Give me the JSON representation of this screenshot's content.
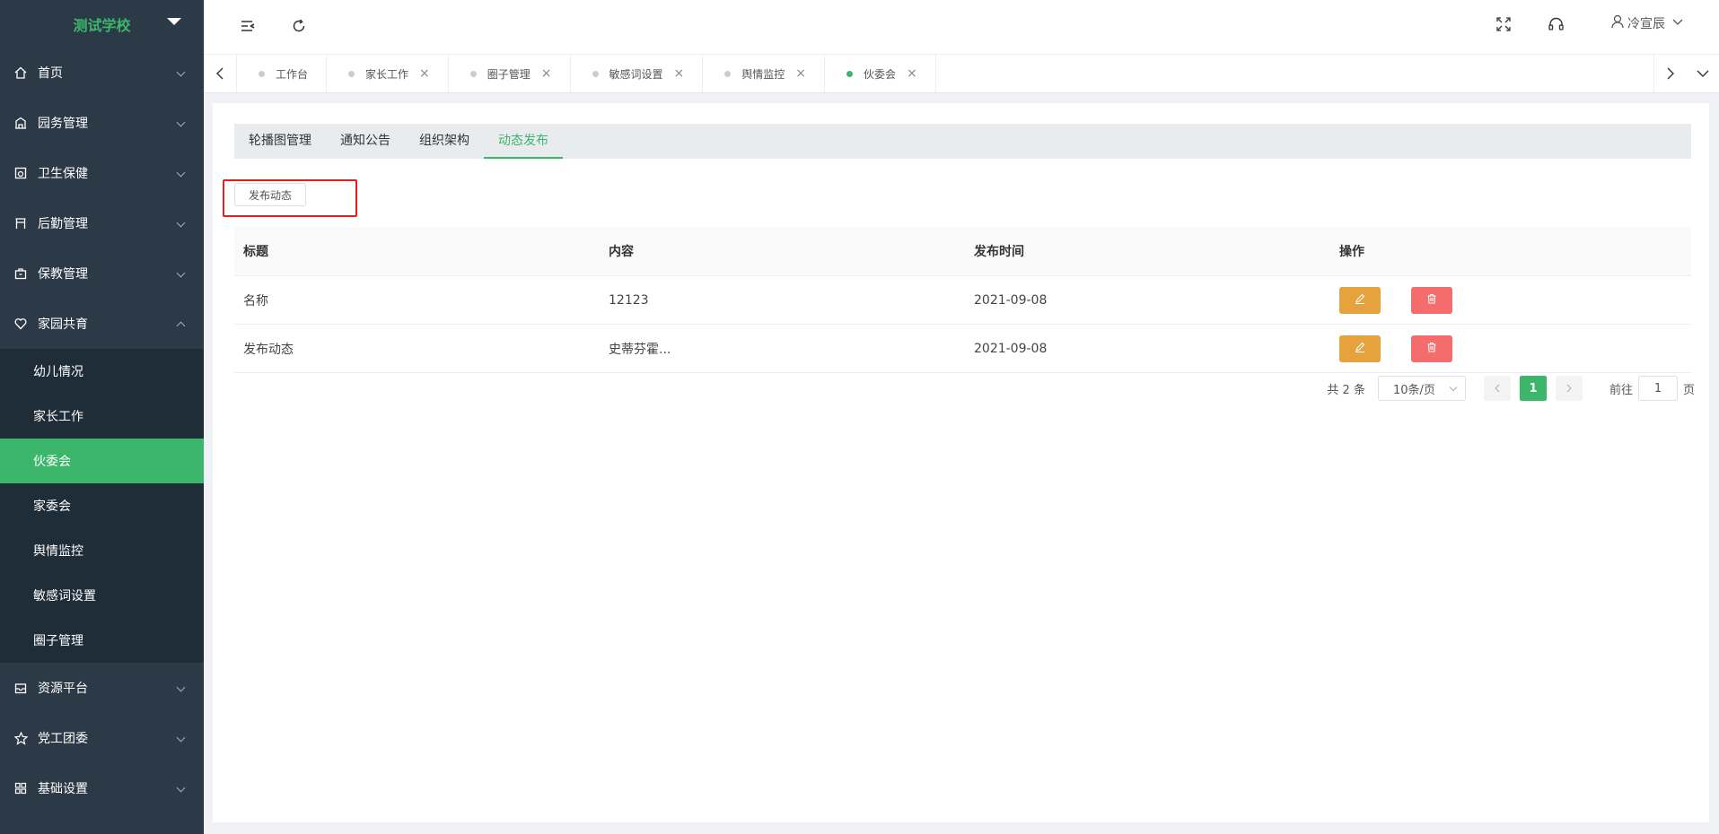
{
  "sidebar": {
    "school_name": "测试学校",
    "menu": [
      {
        "label": "首页",
        "icon": "home-icon",
        "expanded": false
      },
      {
        "label": "园务管理",
        "icon": "building-icon",
        "expanded": false
      },
      {
        "label": "卫生保健",
        "icon": "medical-icon",
        "expanded": false
      },
      {
        "label": "后勤管理",
        "icon": "store-icon",
        "expanded": false
      },
      {
        "label": "保教管理",
        "icon": "briefcase-icon",
        "expanded": false
      },
      {
        "label": "家园共育",
        "icon": "heart-icon",
        "expanded": true
      }
    ],
    "submenu": [
      {
        "label": "幼儿情况",
        "active": false
      },
      {
        "label": "家长工作",
        "active": false
      },
      {
        "label": "伙委会",
        "active": true
      },
      {
        "label": "家委会",
        "active": false
      },
      {
        "label": "舆情监控",
        "active": false
      },
      {
        "label": "敏感词设置",
        "active": false
      },
      {
        "label": "圈子管理",
        "active": false
      }
    ],
    "menu_bottom": [
      {
        "label": "资源平台",
        "icon": "inbox-icon"
      },
      {
        "label": "党工团委",
        "icon": "star-icon"
      },
      {
        "label": "基础设置",
        "icon": "grid-icon"
      }
    ]
  },
  "header": {
    "user_name": "冷宣辰"
  },
  "tabs": [
    {
      "label": "工作台",
      "closable": false,
      "active": false
    },
    {
      "label": "家长工作",
      "closable": true,
      "active": false
    },
    {
      "label": "圈子管理",
      "closable": true,
      "active": false
    },
    {
      "label": "敏感词设置",
      "closable": true,
      "active": false
    },
    {
      "label": "舆情监控",
      "closable": true,
      "active": false
    },
    {
      "label": "伙委会",
      "closable": true,
      "active": true
    }
  ],
  "subtabs": [
    "轮播图管理",
    "通知公告",
    "组织架构",
    "动态发布"
  ],
  "active_subtab": "动态发布",
  "publish_button": "发布动态",
  "table": {
    "headers": [
      "标题",
      "内容",
      "发布时间",
      "操作"
    ],
    "rows": [
      {
        "title": "名称",
        "content": "12123",
        "time": "2021-09-08"
      },
      {
        "title": "发布动态",
        "content": "史蒂芬霍...",
        "time": "2021-09-08"
      }
    ]
  },
  "pagination": {
    "total": "共 2 条",
    "page_size": "10条/页",
    "current_page": "1",
    "goto_prefix": "前往",
    "goto_value": "1",
    "goto_suffix": "页"
  },
  "colors": {
    "accent": "#3cb66a",
    "sidebar": "#2b3a46",
    "edit": "#e6a23c",
    "delete": "#f56c6c",
    "highlight": "#e02020"
  }
}
